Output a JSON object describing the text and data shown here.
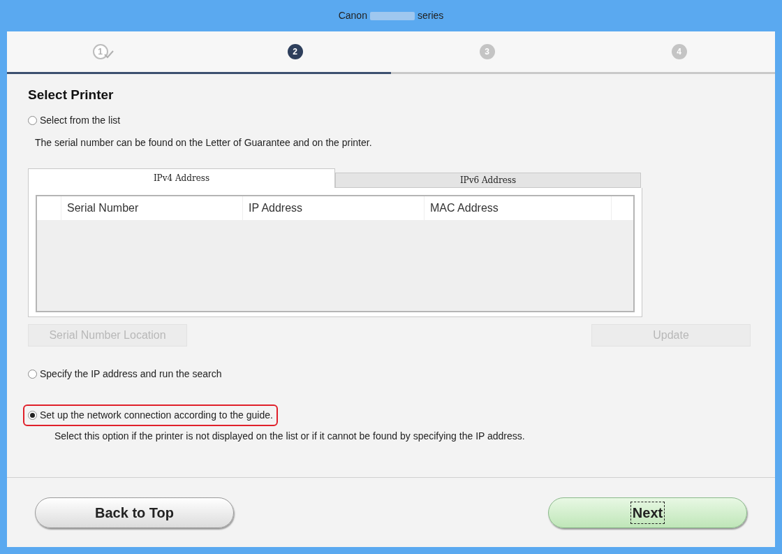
{
  "window": {
    "title_prefix": "Canon",
    "title_suffix": "series"
  },
  "steps": [
    {
      "number": "1",
      "done": true,
      "selected": false
    },
    {
      "number": "2",
      "done": false,
      "selected": true
    },
    {
      "number": "3",
      "done": false,
      "selected": false
    },
    {
      "number": "4",
      "done": false,
      "selected": false
    }
  ],
  "progress": {
    "level": 0.5
  },
  "heading": "Select Printer",
  "option_list": {
    "label": "Select from the list",
    "selected": false,
    "highlighted": false,
    "note": "The serial number can be found on the Letter of Guarantee and on the printer."
  },
  "tabs": [
    {
      "label": "IPv4 Address",
      "selected": true
    },
    {
      "label": "IPv6 Address",
      "selected": false
    }
  ],
  "table": {
    "columns": [
      "Serial Number",
      "IP Address",
      "MAC Address"
    ]
  },
  "buttons_row": [
    {
      "label": "Serial Number Location",
      "disabled": true
    },
    {
      "label": "Update",
      "disabled": true
    }
  ],
  "option_ip": {
    "label": "Specify the IP address and run the search",
    "selected": false,
    "highlighted": false
  },
  "option_guide": {
    "label": "Set up the network connection according to the guide.",
    "selected": true,
    "highlighted": true,
    "note": "Select this option if the printer is not displayed on the list or if it cannot be found by specifying the IP address."
  },
  "footer": {
    "back": "Back to Top",
    "next": "Next"
  }
}
